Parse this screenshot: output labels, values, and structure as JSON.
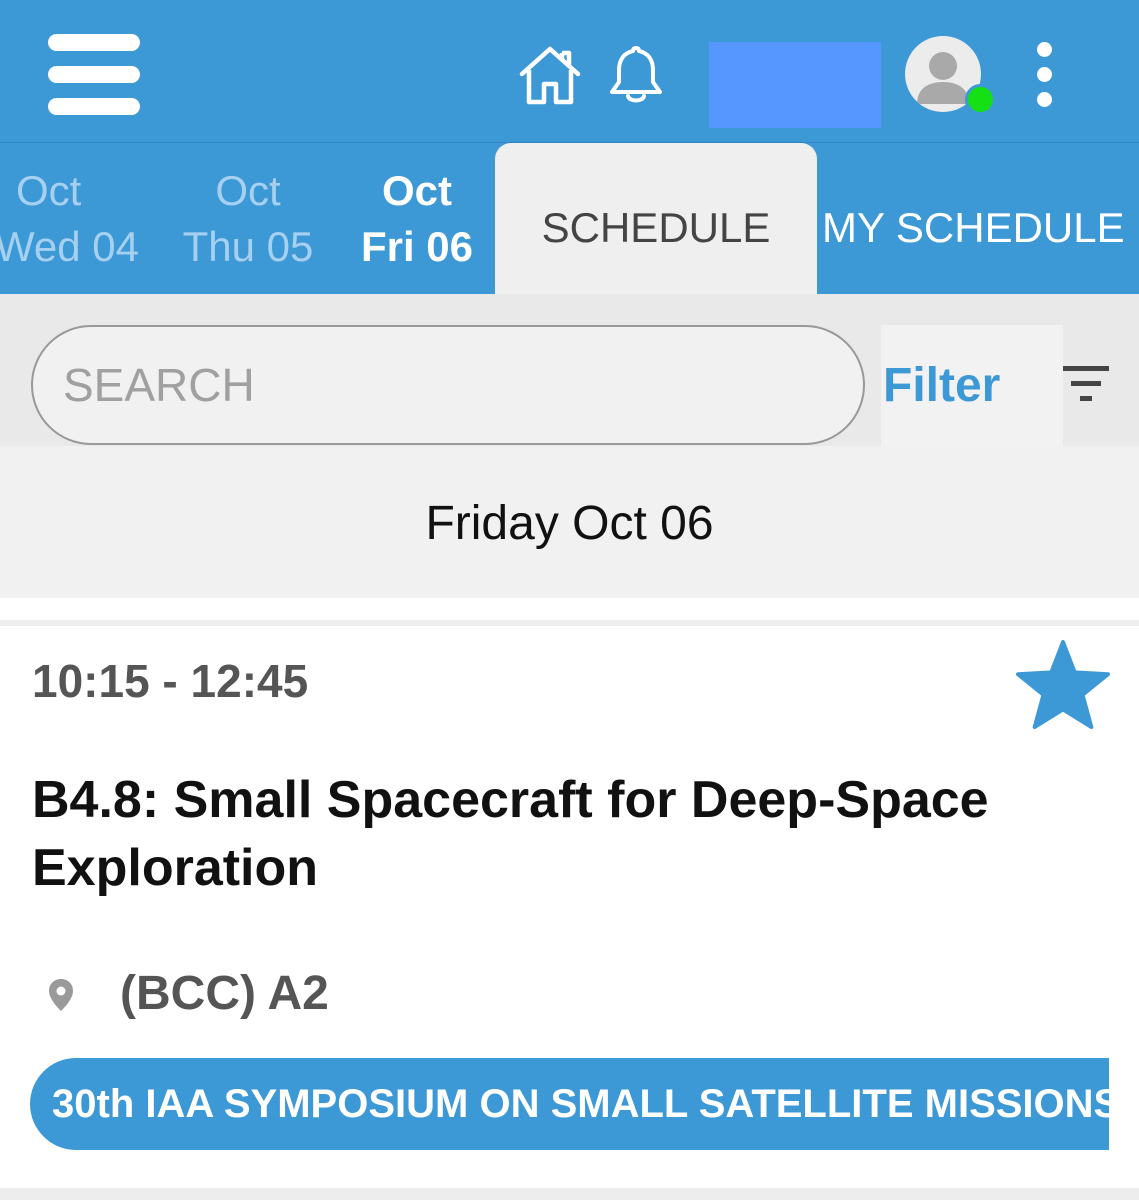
{
  "header": {
    "icons": [
      "menu-icon",
      "home-icon",
      "bell-icon",
      "avatar-icon",
      "kebab-icon"
    ],
    "accent_color": "#3d98d6",
    "status_color": "#14e014"
  },
  "day_tabs": [
    {
      "month": "Oct",
      "day": "Wed 04"
    },
    {
      "month": "Oct",
      "day": "Thu 05"
    },
    {
      "month": "Oct",
      "day": "Fri 06"
    }
  ],
  "view_tabs": {
    "schedule": "SCHEDULE",
    "my_schedule": "MY SCHEDULE"
  },
  "search": {
    "placeholder": "SEARCH",
    "filter_label": "Filter"
  },
  "date_header": "Friday Oct 06",
  "session": {
    "time": "10:15 - 12:45",
    "title": "B4.8: Small Spacecraft for Deep-Space Exploration",
    "location": "(BCC) A2",
    "track": "30th IAA SYMPOSIUM ON SMALL SATELLITE MISSIONS"
  }
}
